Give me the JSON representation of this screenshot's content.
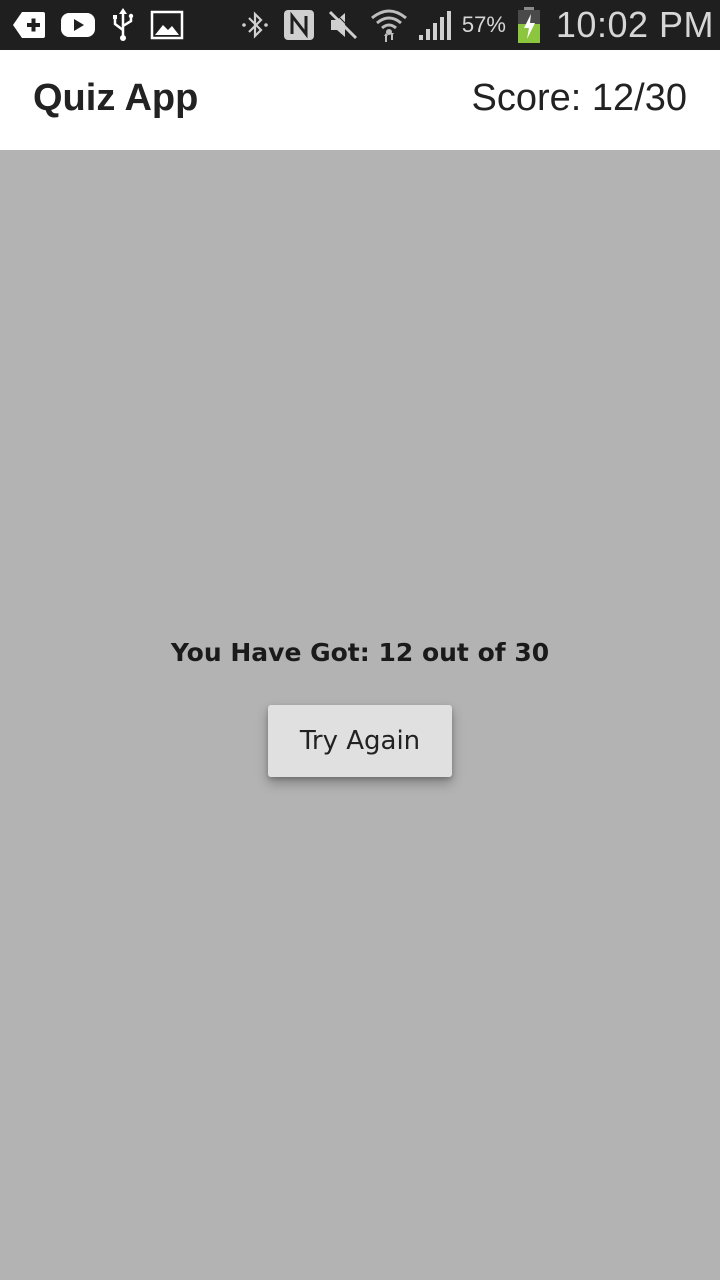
{
  "status_bar": {
    "icons_left": [
      "add-notification-icon",
      "youtube-icon",
      "usb-icon",
      "gallery-icon"
    ],
    "icons_right": [
      "bluetooth-icon",
      "nfc-icon",
      "mute-icon",
      "wifi-icon",
      "signal-icon",
      "battery-charging-icon"
    ],
    "battery_percent": "57%",
    "time": "10:02 PM",
    "battery_color": "#8cc63f"
  },
  "app_bar": {
    "title": "Quiz App",
    "score": "Score: 12/30"
  },
  "result": {
    "message": "You Have Got: 12 out of 30",
    "try_again_label": "Try Again"
  },
  "colors": {
    "background": "#b3b3b3",
    "app_bar": "#ffffff",
    "button": "#e0e0e0",
    "status_bar": "#1f1f1f"
  }
}
